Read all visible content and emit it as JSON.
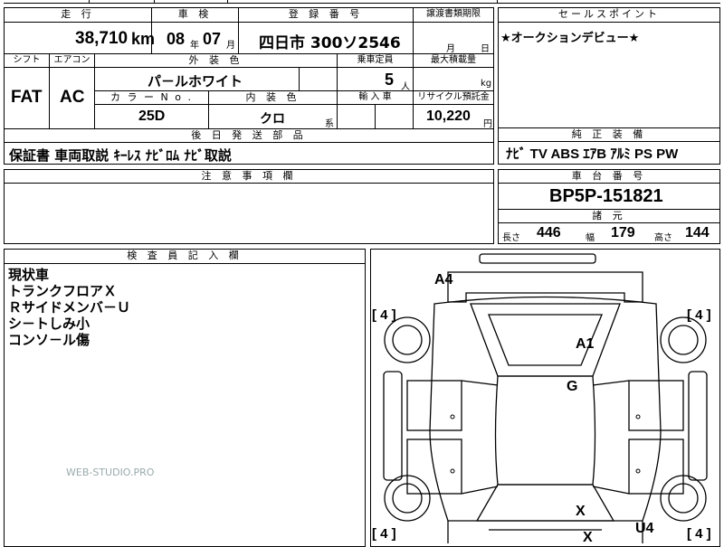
{
  "header": {
    "mileage_label": "走 行",
    "mileage_value": "38,710",
    "mileage_unit": "km",
    "inspection_label": "車 検",
    "inspection_year": "08",
    "inspection_year_unit": "年",
    "inspection_month": "07",
    "inspection_month_unit": "月",
    "registration_label": "登 録 番 号",
    "registration_value": "四日市 300ソ2546",
    "transfer_label": "譲渡書類期限",
    "transfer_month_unit": "月",
    "transfer_day_unit": "日",
    "sales_point_label": "セールスポイント",
    "sales_point_value": "★オークションデビュー★"
  },
  "spec": {
    "shift_label": "シフト",
    "shift_value": "FAT",
    "ac_label": "エアコン",
    "ac_value": "AC",
    "exterior_label": "外 装 色",
    "exterior_value": "パ－ルホワイト",
    "capacity_label": "乗車定員",
    "capacity_value": "5",
    "capacity_unit": "人",
    "load_label": "最大積載量",
    "load_unit": "kg",
    "color_no_label": "カ ラ ー N o .",
    "color_no_value": "25D",
    "interior_label": "内 装 色",
    "interior_value": "クロ",
    "interior_unit": "系",
    "import_label": "輸 入 車",
    "recycle_label": "リサイクル預託金",
    "recycle_value": "10,220",
    "recycle_unit": "円"
  },
  "parts": {
    "label": "後 日 発 送 部 品",
    "value": "保証書 車両取説 ｷｰﾚｽ ﾅﾋﾞﾛﾑ ﾅﾋﾞ取説"
  },
  "equipment": {
    "label": "純 正 装 備",
    "value": "ﾅﾋﾞ TV ABS ｴｱB ｱﾙﾐ PS PW"
  },
  "caution": {
    "label": "注 意 事 項 欄"
  },
  "chassis": {
    "label": "車 台 番 号",
    "value": "BP5P-151821"
  },
  "dimensions": {
    "label": "諸 元",
    "length_label": "長さ",
    "length_value": "446",
    "width_label": "幅",
    "width_value": "179",
    "height_label": "高さ",
    "height_value": "144"
  },
  "inspector": {
    "label": "検 査 員 記 入 欄",
    "notes": [
      "現状車",
      "トランクフロアＸ",
      "Ｒサイドメンバ－Ｕ",
      "シ－トしみ小",
      "コンソ－ル傷"
    ]
  },
  "watermark": "WEB-STUDIO.PRO",
  "diagram": {
    "marks": [
      "A4",
      "A1",
      "G",
      "X",
      "X",
      "U4"
    ],
    "tire_brackets": [
      "[ 4 ]",
      "[ 4 ]",
      "[ 4 ]",
      "[ 4 ]"
    ]
  }
}
